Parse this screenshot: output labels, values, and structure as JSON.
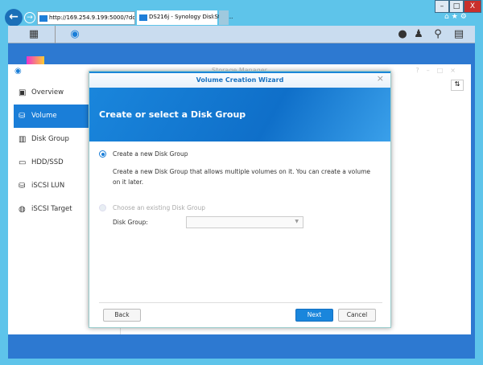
{
  "browser": {
    "address": "http://169.254.9.199:5000/?dc=1",
    "tab_title": "DS216j - Synology DiskStati...",
    "window_buttons": [
      "–",
      "□",
      "X"
    ]
  },
  "storage_manager": {
    "title": "Storage Manager",
    "sidebar": [
      {
        "label": "Overview"
      },
      {
        "label": "Volume"
      },
      {
        "label": "Disk Group"
      },
      {
        "label": "HDD/SSD"
      },
      {
        "label": "iSCSI LUN"
      },
      {
        "label": "iSCSI Target"
      }
    ]
  },
  "wizard": {
    "title": "Volume Creation Wizard",
    "heading": "Create or select a Disk Group",
    "option1": {
      "label": "Create a new Disk Group",
      "description": "Create a new Disk Group that allows multiple volumes on it. You can create a volume on it later.",
      "selected": true
    },
    "option2": {
      "label": "Choose an existing Disk Group",
      "disabled": true
    },
    "disk_group_label": "Disk Group:",
    "disk_group_value": "",
    "buttons": {
      "back": "Back",
      "next": "Next",
      "cancel": "Cancel"
    }
  }
}
